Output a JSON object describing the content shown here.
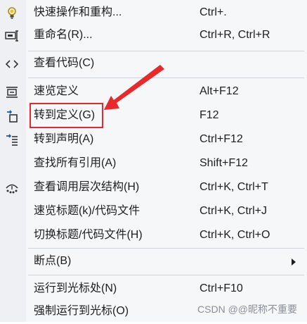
{
  "menu": {
    "items": [
      {
        "label": "快速操作和重构...",
        "shortcut": "Ctrl+.",
        "icon": "lightbulb-icon"
      },
      {
        "label": "重命名(R)...",
        "shortcut": "Ctrl+R, Ctrl+R",
        "icon": "rename-icon"
      },
      {
        "label": "查看代码(C)",
        "shortcut": "",
        "icon": "code-brackets-icon"
      },
      {
        "label": "速览定义",
        "shortcut": "Alt+F12",
        "icon": "peek-definition-icon"
      },
      {
        "label": "转到定义(G)",
        "shortcut": "F12",
        "icon": "go-to-definition-icon"
      },
      {
        "label": "转到声明(A)",
        "shortcut": "Ctrl+F12",
        "icon": "go-to-declaration-icon"
      },
      {
        "label": "查找所有引用(A)",
        "shortcut": "Shift+F12",
        "icon": ""
      },
      {
        "label": "查看调用层次结构(H)",
        "shortcut": "Ctrl+K, Ctrl+T",
        "icon": "call-hierarchy-icon"
      },
      {
        "label": "速览标题(k)/代码文件",
        "shortcut": "Ctrl+K, Ctrl+J",
        "icon": ""
      },
      {
        "label": "切换标题/代码文件(H)",
        "shortcut": "Ctrl+K, Ctrl+O",
        "icon": ""
      },
      {
        "label": "断点(B)",
        "shortcut": "",
        "icon": "submenu-arrow-icon"
      },
      {
        "label": "运行到光标处(N)",
        "shortcut": "Ctrl+F10",
        "icon": ""
      },
      {
        "label": "强制运行到光标(O)",
        "shortcut": "",
        "icon": ""
      }
    ]
  },
  "watermark": "CSDN @@昵称不重要",
  "colors": {
    "background": "#f6f7f9",
    "gutter": "#eef0f4",
    "text": "#1e1e1e",
    "annotation": "#e8282b",
    "icon_blue": "#1f5fa8"
  }
}
